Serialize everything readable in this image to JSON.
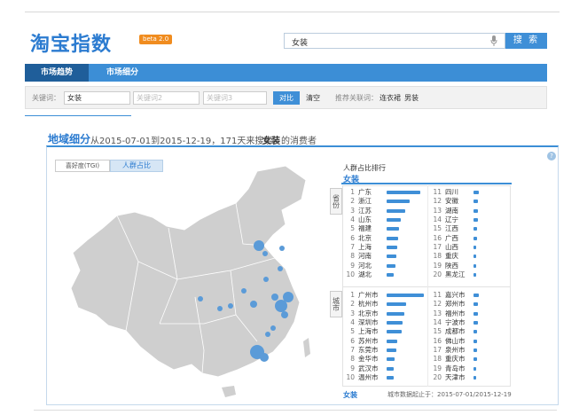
{
  "brand": {
    "logo": "淘宝指数",
    "beta": "beta 2.0"
  },
  "search": {
    "value": "女装",
    "button": "搜 索"
  },
  "nav": {
    "tab_market": "市场趋势",
    "tab_segment": "市场细分"
  },
  "keywords": {
    "label": "关键词：",
    "kw1": "女装",
    "kw2": "关键词2",
    "kw3": "关键词3",
    "compare": "对比",
    "clear": "清空",
    "recommend_label": "推荐关联词：",
    "rec1": "连衣裙",
    "rec2": "男装"
  },
  "section": {
    "title": "地域细分",
    "subtitle": "从2015-07-01到2015-12-19，171天来搜索",
    "keyword": "女装",
    "suffix": "的消费者",
    "help": "?"
  },
  "tabs": {
    "preference": "喜好度(TGI)",
    "share": "人群占比"
  },
  "ranking": {
    "title": "人群占比排行",
    "keyword": "女装",
    "province_label": "省份",
    "city_label": "城市",
    "provinces_left": [
      {
        "n": "1",
        "name": "广东",
        "v": 0.9
      },
      {
        "n": "2",
        "name": "浙江",
        "v": 0.62
      },
      {
        "n": "3",
        "name": "江苏",
        "v": 0.5
      },
      {
        "n": "4",
        "name": "山东",
        "v": 0.38
      },
      {
        "n": "5",
        "name": "福建",
        "v": 0.34
      },
      {
        "n": "6",
        "name": "北京",
        "v": 0.3
      },
      {
        "n": "7",
        "name": "上海",
        "v": 0.28
      },
      {
        "n": "8",
        "name": "河南",
        "v": 0.25
      },
      {
        "n": "9",
        "name": "河北",
        "v": 0.23
      },
      {
        "n": "10",
        "name": "湖北",
        "v": 0.2
      }
    ],
    "provinces_right": [
      {
        "n": "11",
        "name": "四川",
        "v": 0.14
      },
      {
        "n": "12",
        "name": "安徽",
        "v": 0.13
      },
      {
        "n": "13",
        "name": "湖南",
        "v": 0.12
      },
      {
        "n": "14",
        "name": "辽宁",
        "v": 0.11
      },
      {
        "n": "15",
        "name": "江西",
        "v": 0.1
      },
      {
        "n": "16",
        "name": "广西",
        "v": 0.09
      },
      {
        "n": "17",
        "name": "山西",
        "v": 0.08
      },
      {
        "n": "18",
        "name": "重庆",
        "v": 0.07
      },
      {
        "n": "19",
        "name": "陕西",
        "v": 0.07
      },
      {
        "n": "20",
        "name": "黑龙江",
        "v": 0.06
      }
    ],
    "cities_left": [
      {
        "n": "1",
        "name": "广州市",
        "v": 1.0
      },
      {
        "n": "2",
        "name": "杭州市",
        "v": 0.52
      },
      {
        "n": "3",
        "name": "北京市",
        "v": 0.48
      },
      {
        "n": "4",
        "name": "深圳市",
        "v": 0.44
      },
      {
        "n": "5",
        "name": "上海市",
        "v": 0.4
      },
      {
        "n": "6",
        "name": "苏州市",
        "v": 0.28
      },
      {
        "n": "7",
        "name": "东莞市",
        "v": 0.25
      },
      {
        "n": "8",
        "name": "金华市",
        "v": 0.22
      },
      {
        "n": "9",
        "name": "武汉市",
        "v": 0.2
      },
      {
        "n": "10",
        "name": "温州市",
        "v": 0.18
      }
    ],
    "cities_right": [
      {
        "n": "11",
        "name": "嘉兴市",
        "v": 0.14
      },
      {
        "n": "12",
        "name": "郑州市",
        "v": 0.13
      },
      {
        "n": "13",
        "name": "福州市",
        "v": 0.12
      },
      {
        "n": "14",
        "name": "宁波市",
        "v": 0.11
      },
      {
        "n": "15",
        "name": "成都市",
        "v": 0.1
      },
      {
        "n": "16",
        "name": "佛山市",
        "v": 0.1
      },
      {
        "n": "17",
        "name": "泉州市",
        "v": 0.09
      },
      {
        "n": "18",
        "name": "重庆市",
        "v": 0.09
      },
      {
        "n": "19",
        "name": "青岛市",
        "v": 0.08
      },
      {
        "n": "20",
        "name": "天津市",
        "v": 0.08
      }
    ],
    "footer_kw": "女装",
    "footer_text": "城市数据起止于：2015-07-01/2015-12-19"
  },
  "colors": {
    "accent": "#3c8ed6",
    "dark": "#1f5e9a",
    "map": "#cdcdcd"
  }
}
